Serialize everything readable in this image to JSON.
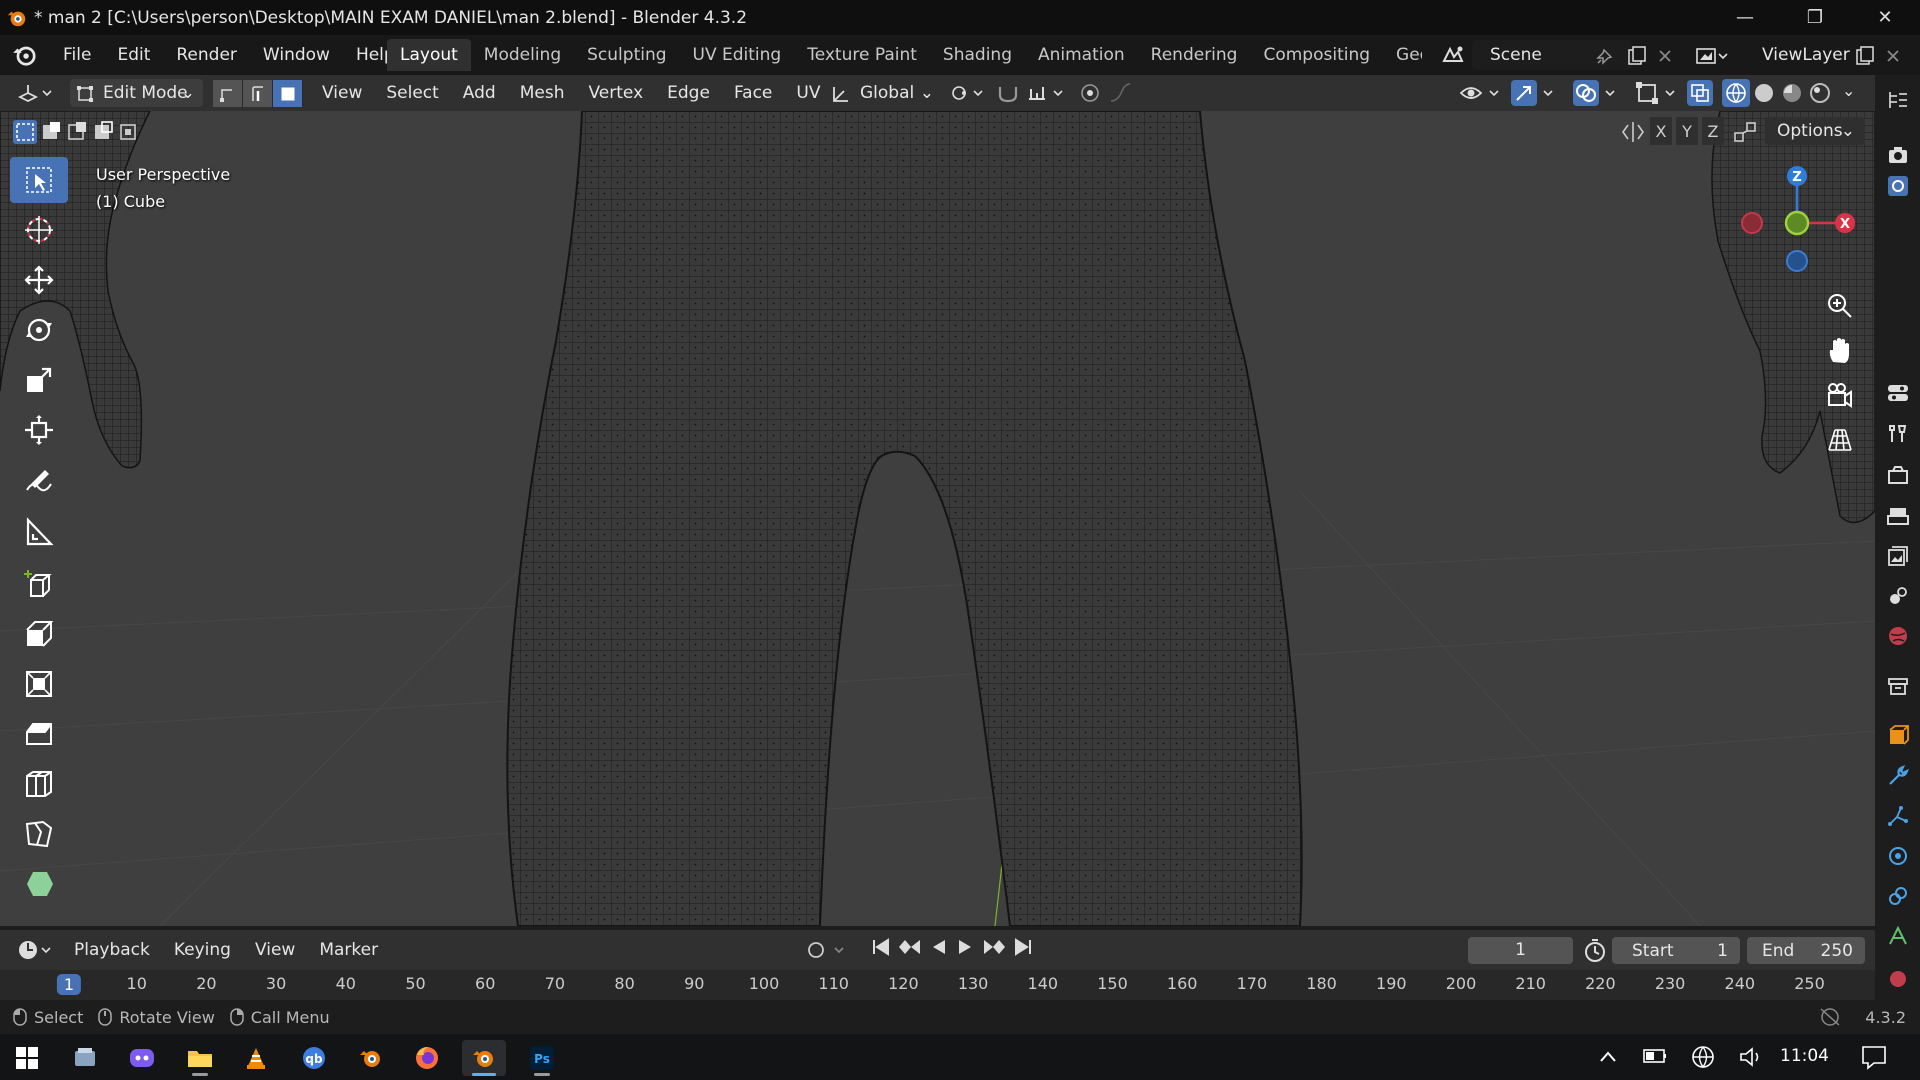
{
  "window": {
    "title": "* man 2 [C:\\Users\\person\\Desktop\\MAIN EXAM DANIEL\\man 2.blend] - Blender 4.3.2",
    "controls": [
      "minimize-icon",
      "restore-icon",
      "close-icon"
    ]
  },
  "menubar": {
    "items": [
      "File",
      "Edit",
      "Render",
      "Window",
      "Help"
    ]
  },
  "workspaces": {
    "tabs": [
      "Layout",
      "Modeling",
      "Sculpting",
      "UV Editing",
      "Texture Paint",
      "Shading",
      "Animation",
      "Rendering",
      "Compositing",
      "Geome"
    ],
    "active": "Layout"
  },
  "scene": {
    "name": "Scene"
  },
  "view_layer": {
    "name": "ViewLayer"
  },
  "viewport_header": {
    "mode": "Edit Mode",
    "menus": [
      "View",
      "Select",
      "Add",
      "Mesh",
      "Vertex",
      "Edge",
      "Face",
      "UV"
    ],
    "transform_orientation": "Global",
    "select_mode_active": "face"
  },
  "viewport": {
    "perspective": "User Perspective",
    "object": "(1) Cube",
    "axis_labels": [
      "X",
      "Y",
      "Z"
    ],
    "options_label": "Options",
    "gizmo_labels": {
      "x": "X",
      "z": "Z"
    }
  },
  "toolbar": {
    "tools": [
      "select-box-icon",
      "cursor-icon",
      "move-icon",
      "rotate-icon",
      "scale-icon",
      "transform-icon",
      "annotate-icon",
      "measure-icon",
      "add-cube-icon",
      "extrude-icon",
      "inset-icon",
      "bevel-icon",
      "loop-cut-icon",
      "knife-icon",
      "poly-build-icon"
    ],
    "active": "select-box-icon"
  },
  "timeline": {
    "menus": [
      "Playback",
      "Keying",
      "View",
      "Marker"
    ],
    "current_frame": "1",
    "start_label": "Start",
    "start_value": "1",
    "end_label": "End",
    "end_value": "250",
    "ruler": [
      "1",
      "10",
      "20",
      "30",
      "40",
      "50",
      "60",
      "70",
      "80",
      "90",
      "100",
      "110",
      "120",
      "130",
      "140",
      "150",
      "160",
      "170",
      "180",
      "190",
      "200",
      "210",
      "220",
      "230",
      "240",
      "250"
    ]
  },
  "statusbar": {
    "items": [
      "Select",
      "Rotate View",
      "Call Menu"
    ],
    "version": "4.3.2"
  },
  "taskbar": {
    "clock": "11:04",
    "apps": [
      "start-icon",
      "file-manager-icon",
      "discord-icon",
      "folder-icon",
      "vlc-icon",
      "qbittorrent-icon",
      "blender-icon",
      "firefox-icon",
      "blender-active-icon",
      "photoshop-icon"
    ],
    "photoshop_label": "Ps",
    "qb_label": "qb"
  },
  "colors": {
    "accent": "#4772b3",
    "viewport_bg": "#3f3f3f",
    "axis_x": "#d83447",
    "axis_y": "#7fb32e",
    "axis_z": "#2f7dd9"
  }
}
